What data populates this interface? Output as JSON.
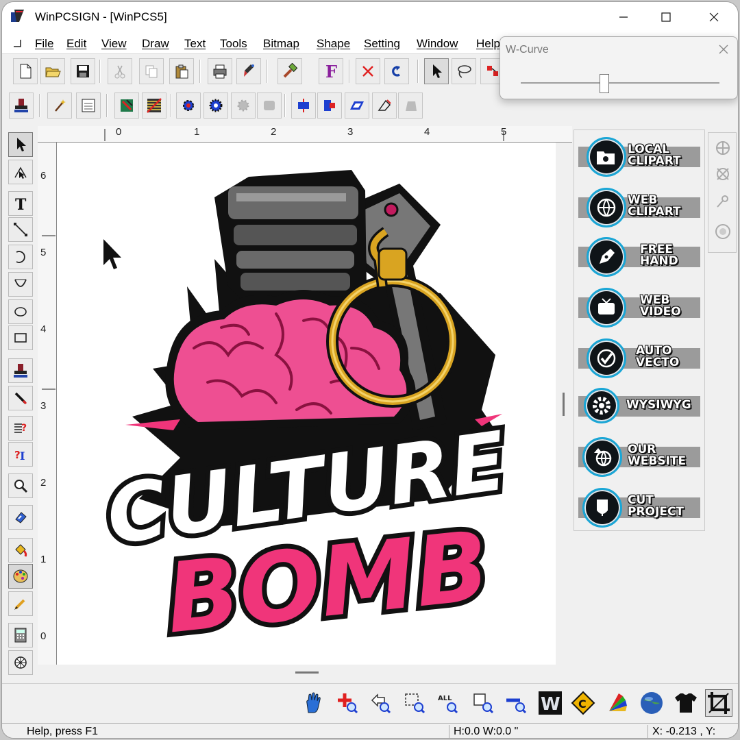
{
  "window": {
    "title": "WinPCSIGN - [WinPCS5]"
  },
  "menu": [
    "File",
    "Edit",
    "View",
    "Draw",
    "Text",
    "Tools",
    "Bitmap",
    "Shape",
    "Setting",
    "Window",
    "Help"
  ],
  "w_curve": {
    "title": "W-Curve",
    "value": 0.42
  },
  "ruler": {
    "horizontal": [
      "0",
      "1",
      "2",
      "3",
      "4",
      "5"
    ],
    "vertical": [
      "6",
      "5",
      "4",
      "3",
      "2",
      "1",
      "0"
    ]
  },
  "artwork": {
    "line1": "CULTURE",
    "line2": "BOMB",
    "colors": {
      "pink": "#f0357a",
      "brain": "#ee4f92",
      "metal": "#5f5f5f",
      "gold": "#d9a421"
    }
  },
  "side_panel": [
    {
      "lines": [
        "LOCAL",
        "CLIPART"
      ],
      "icon": "folder-icon"
    },
    {
      "lines": [
        "WEB",
        "CLIPART"
      ],
      "icon": "globe-upload-icon"
    },
    {
      "lines": [
        "FREE",
        "HAND"
      ],
      "icon": "pen-nib-icon"
    },
    {
      "lines": [
        "WEB",
        "VIDEO"
      ],
      "icon": "tv-icon"
    },
    {
      "lines": [
        "AUTO",
        "VECTO"
      ],
      "icon": "checkmark-icon"
    },
    {
      "lines": [
        "WYSIWYG"
      ],
      "icon": "gear-icon"
    },
    {
      "lines": [
        "OUR",
        "WEBSITE"
      ],
      "icon": "globe-arrow-icon"
    },
    {
      "lines": [
        "CUT",
        "PROJECT"
      ],
      "icon": "cutter-icon"
    }
  ],
  "status": {
    "help": "Help, press F1",
    "size": "H:0.0   W:0.0 \"",
    "coords": "X: -0.213 , Y:"
  }
}
